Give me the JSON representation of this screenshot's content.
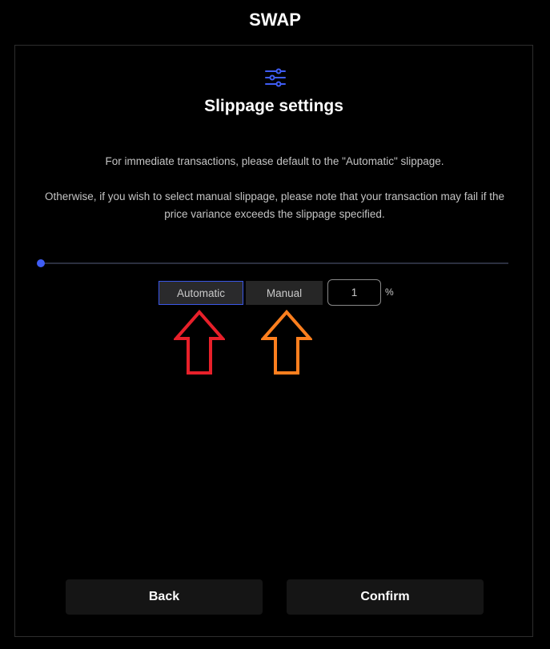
{
  "header": {
    "title": "SWAP"
  },
  "panel": {
    "icon": "sliders-icon",
    "heading": "Slippage settings",
    "description_1": "For immediate transactions, please default to the \"Automatic\" slippage.",
    "description_2": "Otherwise, if you wish to select manual slippage, please note that your transaction may fail if the price variance exceeds the slippage specified."
  },
  "slider": {
    "value_fraction": 0.0
  },
  "mode": {
    "automatic_label": "Automatic",
    "manual_label": "Manual",
    "selected": "Automatic"
  },
  "slippage_input": {
    "value": "1",
    "unit": "%"
  },
  "annotations": [
    {
      "name": "red-arrow-up-icon",
      "color": "#e8202a"
    },
    {
      "name": "orange-arrow-up-icon",
      "color": "#ff7f1e"
    }
  ],
  "footer": {
    "back_label": "Back",
    "confirm_label": "Confirm"
  },
  "colors": {
    "accent": "#3f5df5",
    "background": "#000000",
    "button": "#151515"
  }
}
